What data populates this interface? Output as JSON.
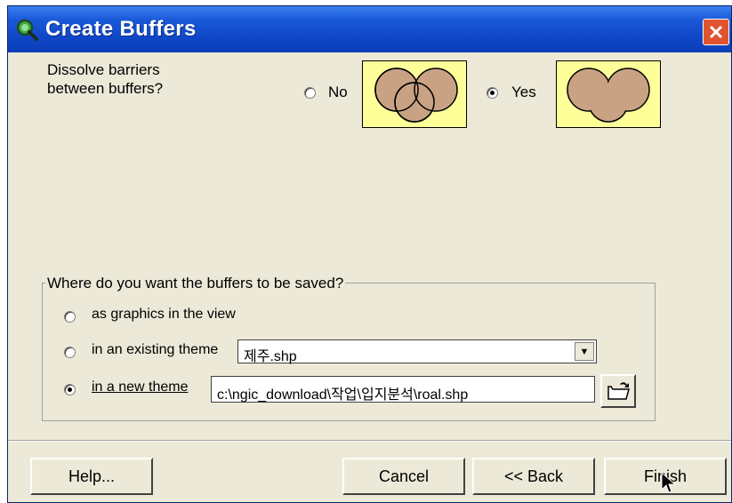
{
  "window": {
    "title": "Create Buffers"
  },
  "dissolve": {
    "label_line1": "Dissolve barriers",
    "label_line2": "between buffers?",
    "option_no": "No",
    "option_yes": "Yes",
    "selected": "Yes"
  },
  "save_group": {
    "legend": "Where do you want the buffers to be saved?",
    "option_graphics": "as graphics in the view",
    "option_existing": "in an existing theme",
    "option_new": "in a new theme",
    "selected": "in a new theme",
    "existing_theme_value": "제주.shp",
    "new_theme_path": "c:\\ngic_download\\작업\\입지분석\\roal.shp"
  },
  "buttons": {
    "help": "Help...",
    "cancel": "Cancel",
    "back": "<< Back",
    "finish": "Finish"
  },
  "icons": {
    "app": "magnifier-icon",
    "close": "close-icon",
    "browse": "open-folder-icon",
    "combo_arrow": "chevron-down-icon"
  },
  "colors": {
    "titlebar": "#1a58d8",
    "preview_bg": "#ffff99",
    "buffer_fill": "#c9a284",
    "close_button": "#e2532f"
  }
}
